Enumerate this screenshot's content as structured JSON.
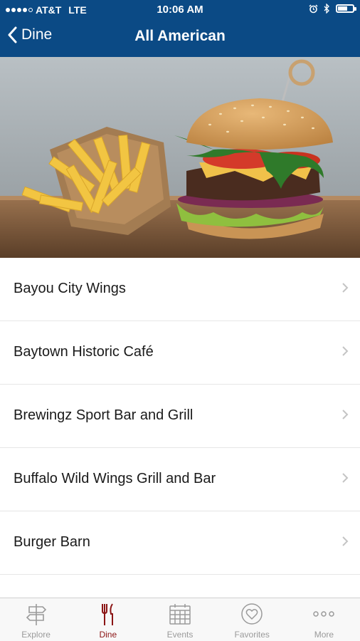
{
  "status": {
    "carrier": "AT&T",
    "network": "LTE",
    "time": "10:06 AM"
  },
  "nav": {
    "back_label": "Dine",
    "title": "All American"
  },
  "hero": {
    "icon": "burger-and-fries-photo"
  },
  "restaurants": [
    {
      "name": "Bayou City Wings"
    },
    {
      "name": "Baytown Historic Café"
    },
    {
      "name": "Brewingz Sport Bar and Grill"
    },
    {
      "name": "Buffalo Wild Wings Grill and Bar"
    },
    {
      "name": "Burger Barn"
    }
  ],
  "tabs": [
    {
      "label": "Explore",
      "icon": "signpost-icon"
    },
    {
      "label": "Dine",
      "icon": "fork-knife-icon",
      "active": true
    },
    {
      "label": "Events",
      "icon": "calendar-icon"
    },
    {
      "label": "Favorites",
      "icon": "heart-icon"
    },
    {
      "label": "More",
      "icon": "more-dots-icon"
    }
  ],
  "colors": {
    "header": "#0b4a85",
    "active_tab": "#8b1414",
    "inactive_tab": "#9a9a9a"
  }
}
